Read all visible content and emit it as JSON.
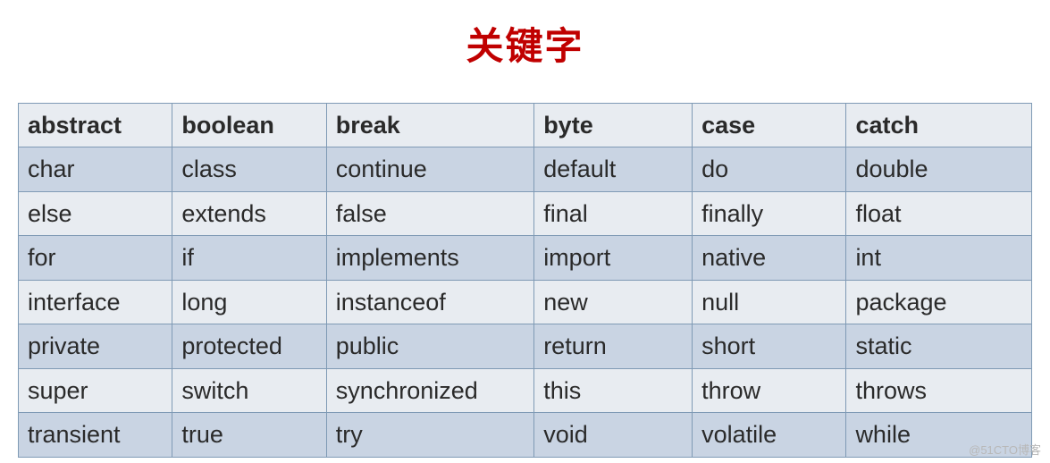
{
  "title": "关键字",
  "watermark": "@51CTO博客",
  "table": {
    "header": [
      "abstract",
      "boolean",
      "break",
      "byte",
      "case",
      "catch"
    ],
    "rows": [
      [
        "char",
        "class",
        "continue",
        "default",
        "do",
        "double"
      ],
      [
        "else",
        "extends",
        "false",
        "final",
        "finally",
        "float"
      ],
      [
        "for",
        "if",
        "implements",
        "import",
        "native",
        "int"
      ],
      [
        "interface",
        "long",
        "instanceof",
        "new",
        "null",
        "package"
      ],
      [
        "private",
        "protected",
        "public",
        "return",
        "short",
        "static"
      ],
      [
        "super",
        "switch",
        "synchronized",
        "this",
        "throw",
        "throws"
      ],
      [
        "transient",
        "true",
        "try",
        "void",
        "volatile",
        "while"
      ]
    ]
  }
}
